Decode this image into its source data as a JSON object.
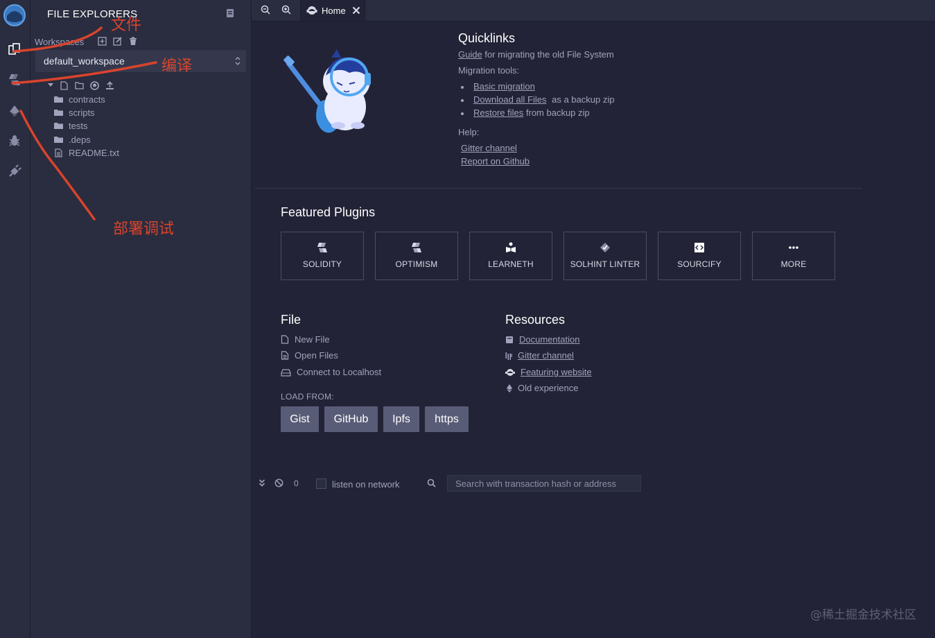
{
  "rail": {
    "items": [
      {
        "name": "logo",
        "icon": "remix-logo-icon"
      },
      {
        "name": "file-explorer",
        "icon": "files-icon"
      },
      {
        "name": "solidity-compiler",
        "icon": "solidity-icon"
      },
      {
        "name": "deploy-run",
        "icon": "ethereum-icon"
      },
      {
        "name": "debugger",
        "icon": "bug-icon"
      },
      {
        "name": "plugin-manager",
        "icon": "plug-icon"
      }
    ]
  },
  "sidebar": {
    "title": "FILE EXPLORERS",
    "workspaces_label": "Workspaces",
    "workspace_selected": "default_workspace",
    "tree": [
      {
        "label": "contracts",
        "kind": "folder"
      },
      {
        "label": "scripts",
        "kind": "folder"
      },
      {
        "label": "tests",
        "kind": "folder"
      },
      {
        "label": ".deps",
        "kind": "folder"
      },
      {
        "label": "README.txt",
        "kind": "file"
      }
    ]
  },
  "tabs": [
    {
      "label": "Home",
      "active": true
    }
  ],
  "quicklinks": {
    "title": "Quicklinks",
    "guide_link": "Guide",
    "guide_text": "for migrating the old File System",
    "migration_label": "Migration tools:",
    "migration_items": [
      {
        "link": "Basic migration",
        "text": ""
      },
      {
        "link": "Download all Files",
        "text": "as a backup zip"
      },
      {
        "link": "Restore files",
        "text": "from backup zip"
      }
    ],
    "help_label": "Help:",
    "help_links": [
      "Gitter channel",
      "Report on Github"
    ]
  },
  "featured": {
    "title": "Featured Plugins",
    "plugins": [
      {
        "label": "SOLIDITY",
        "icon": "solidity-icon"
      },
      {
        "label": "OPTIMISM",
        "icon": "optimism-icon"
      },
      {
        "label": "LEARNETH",
        "icon": "book-reader-icon"
      },
      {
        "label": "SOLHINT LINTER",
        "icon": "solhint-icon"
      },
      {
        "label": "SOURCIFY",
        "icon": "sourcify-icon"
      },
      {
        "label": "MORE",
        "icon": "ellipsis-icon"
      }
    ]
  },
  "file_section": {
    "title": "File",
    "items": [
      "New File",
      "Open Files",
      "Connect to Localhost"
    ],
    "load_from_label": "LOAD FROM:",
    "load_buttons": [
      "Gist",
      "GitHub",
      "Ipfs",
      "https"
    ]
  },
  "resources": {
    "title": "Resources",
    "items": [
      {
        "label": "Documentation",
        "link": true
      },
      {
        "label": "Gitter channel",
        "link": true
      },
      {
        "label": "Featuring website",
        "link": true
      },
      {
        "label": "Old experience",
        "link": false
      }
    ]
  },
  "terminal": {
    "count": "0",
    "listen_label": "listen on network",
    "search_placeholder": "Search with transaction hash or address"
  },
  "annotations": {
    "file": "文件",
    "compile": "编译",
    "deploy": "部署调试",
    "color": "#d9442c"
  },
  "watermark": "@稀土掘金技术社区"
}
